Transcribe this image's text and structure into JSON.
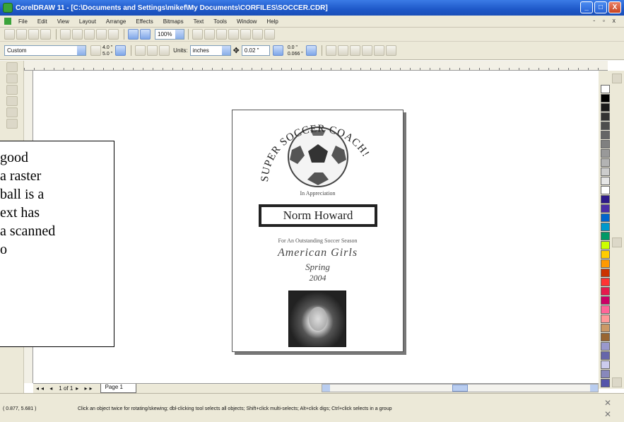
{
  "window": {
    "title": "CorelDRAW 11 - [C:\\Documents and Settings\\mikef\\My Documents\\CORFILES\\SOCCER.CDR]",
    "buttons": [
      "_",
      "□",
      "X"
    ]
  },
  "menu": [
    "File",
    "Edit",
    "View",
    "Layout",
    "Arrange",
    "Effects",
    "Bitmaps",
    "Text",
    "Tools",
    "Window",
    "Help"
  ],
  "toolbar": {
    "zoom": "100%",
    "paper": "Custom",
    "width": "4.0 \"",
    "height": "5.0 \"",
    "units_label": "Units:",
    "units": "inches",
    "nudge": "0.02 \"",
    "dup_x": "0.0 \"",
    "dup_y": "0.066 \""
  },
  "document": {
    "arc_text": "SUPER SOCCER COACH!",
    "appreciation": "In Appreciation",
    "name": "Norm Howard",
    "season_line": "For An Outstanding Soccer Season",
    "team": "American Girls",
    "season": "Spring",
    "year": "2004"
  },
  "callout": {
    "lines": [
      "good",
      "a raster",
      "ball is a",
      "ext has",
      "a scanned",
      "o"
    ]
  },
  "pagebar": {
    "page_count": "1 of 1",
    "tab": "Page 1"
  },
  "status": {
    "coords": "( 0.877, 5.681 )",
    "hint": "Click an object twice for rotating/skewing; dbl-clicking tool selects all objects; Shift+click multi-selects; Alt+click digs; Ctrl+click selects in a group"
  },
  "palette_colors": [
    "#ffffff",
    "#000000",
    "#1a1a1a",
    "#333333",
    "#4d4d4d",
    "#666666",
    "#808080",
    "#999999",
    "#b3b3b3",
    "#cccccc",
    "#e6e6e6",
    "#ffffff",
    "#2e1a8a",
    "#4b2fa8",
    "#0066cc",
    "#0099cc",
    "#009966",
    "#ccff00",
    "#ffcc00",
    "#ff9900",
    "#cc3300",
    "#ff3333",
    "#e51a4c",
    "#cc0066",
    "#ff6699",
    "#ff9999",
    "#cc9966",
    "#996633",
    "#9999cc",
    "#6666aa",
    "#ccccee",
    "#8888bb",
    "#5555aa"
  ]
}
